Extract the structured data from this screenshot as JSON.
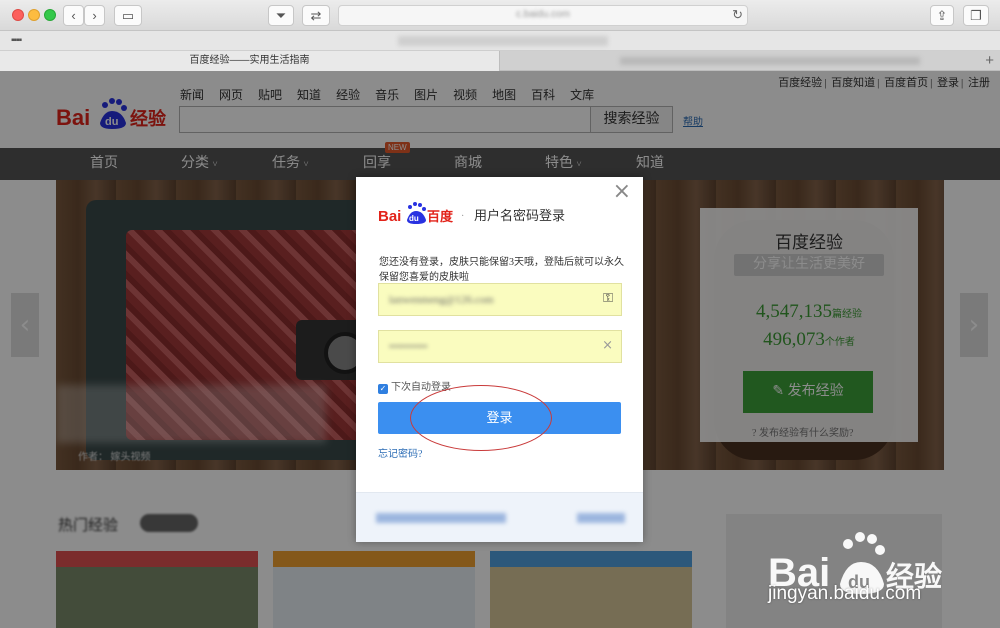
{
  "browser": {
    "url": "c.baidu.com",
    "tabs": [
      {
        "label": "百度经验——实用生活指南"
      },
      {
        "label": ""
      }
    ]
  },
  "header": {
    "top_links": [
      "百度经验",
      "百度知道",
      "百度首页",
      "登录",
      "注册"
    ],
    "nav": [
      "新闻",
      "网页",
      "贴吧",
      "知道",
      "经验",
      "音乐",
      "图片",
      "视频",
      "地图",
      "百科",
      "文库"
    ],
    "search_button": "搜索经验",
    "help_link": "帮助"
  },
  "main_nav": {
    "items": [
      "首页",
      "分类",
      "任务",
      "回享",
      "商城",
      "特色",
      "知道"
    ],
    "new_badge": "NEW"
  },
  "banner": {
    "author_label": "作者：",
    "author_name": "嫁头视频"
  },
  "side_card": {
    "title": "百度经验",
    "slogan": "分享让生活更美好",
    "count_experiences": "4,547,135",
    "unit_experiences": "篇经验",
    "count_authors": "496,073",
    "unit_authors": "个作者",
    "publish_button": "发布经验",
    "reward_text": "发布经验有什么奖励?"
  },
  "bottom": {
    "section_title": "热门经验"
  },
  "dialog": {
    "logo_text": "百度",
    "title": "用户名密码登录",
    "message": "您还没有登录，皮肤只能保留3天哦，登陆后就可以永久保留您喜爱的皮肤啦",
    "username": "lanwenmeng@126.com",
    "password": "••••••••••",
    "remember_label": "下次自动登录",
    "login_button": "登录",
    "forgot_link": "忘记密码?"
  },
  "watermark": {
    "brand": "Baidu经验",
    "url": "jingyan.baidu.com"
  },
  "colors": {
    "accent_blue": "#3b8ff0",
    "baidu_red": "#e2231a",
    "baidu_blue": "#2932e1",
    "publish_green": "#3ca13a",
    "nav_bar": "#555555"
  }
}
